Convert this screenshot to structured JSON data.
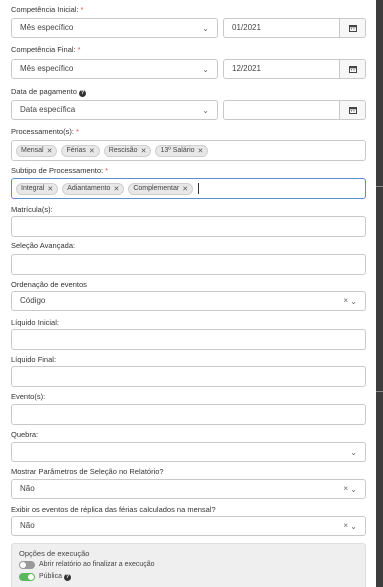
{
  "competencia_inicial": {
    "label": "Competência Inicial:",
    "required": "*",
    "select": "Mês específico",
    "date": "01/2021"
  },
  "competencia_final": {
    "label": "Competência Final:",
    "required": "*",
    "select": "Mês específico",
    "date": "12/2021"
  },
  "data_pagamento": {
    "label": "Data de pagamento",
    "select": "Data específica",
    "date": ""
  },
  "processamentos": {
    "label": "Processamento(s):",
    "required": "*",
    "tags": [
      "Mensal",
      "Férias",
      "Rescisão",
      "13º Salário"
    ]
  },
  "subtipo": {
    "label": "Subtipo de Processamento:",
    "required": "*",
    "tags": [
      "Integral",
      "Adiantamento",
      "Complementar"
    ]
  },
  "matriculas": {
    "label": "Matrícula(s):",
    "value": ""
  },
  "selecao_avancada": {
    "label": "Seleção Avançada:",
    "value": ""
  },
  "ordenacao": {
    "label": "Ordenação de eventos",
    "value": "Código"
  },
  "liquido_inicial": {
    "label": "Líquido Inicial:",
    "value": ""
  },
  "liquido_final": {
    "label": "Líquido Final:",
    "value": ""
  },
  "eventos": {
    "label": "Evento(s):",
    "value": ""
  },
  "quebra": {
    "label": "Quebra:",
    "value": ""
  },
  "mostrar_parametros": {
    "label": "Mostrar Parâmetros de Seleção no Relatório?",
    "value": "Não"
  },
  "exibir_replica": {
    "label": "Exibir os eventos de réplica das férias calculados na mensal?",
    "value": "Não"
  },
  "opcoes_execucao": {
    "title": "Opções de execução",
    "abrir_relatorio": {
      "label": "Abrir relatório ao finalizar a execução",
      "on": false
    },
    "publica": {
      "label": "Pública",
      "on": true
    }
  },
  "colors": {
    "required": "#d9534f",
    "focus_border": "#5b8dd6",
    "toggle_on": "#5cb85c",
    "toggle_off": "#9a9a9a"
  }
}
